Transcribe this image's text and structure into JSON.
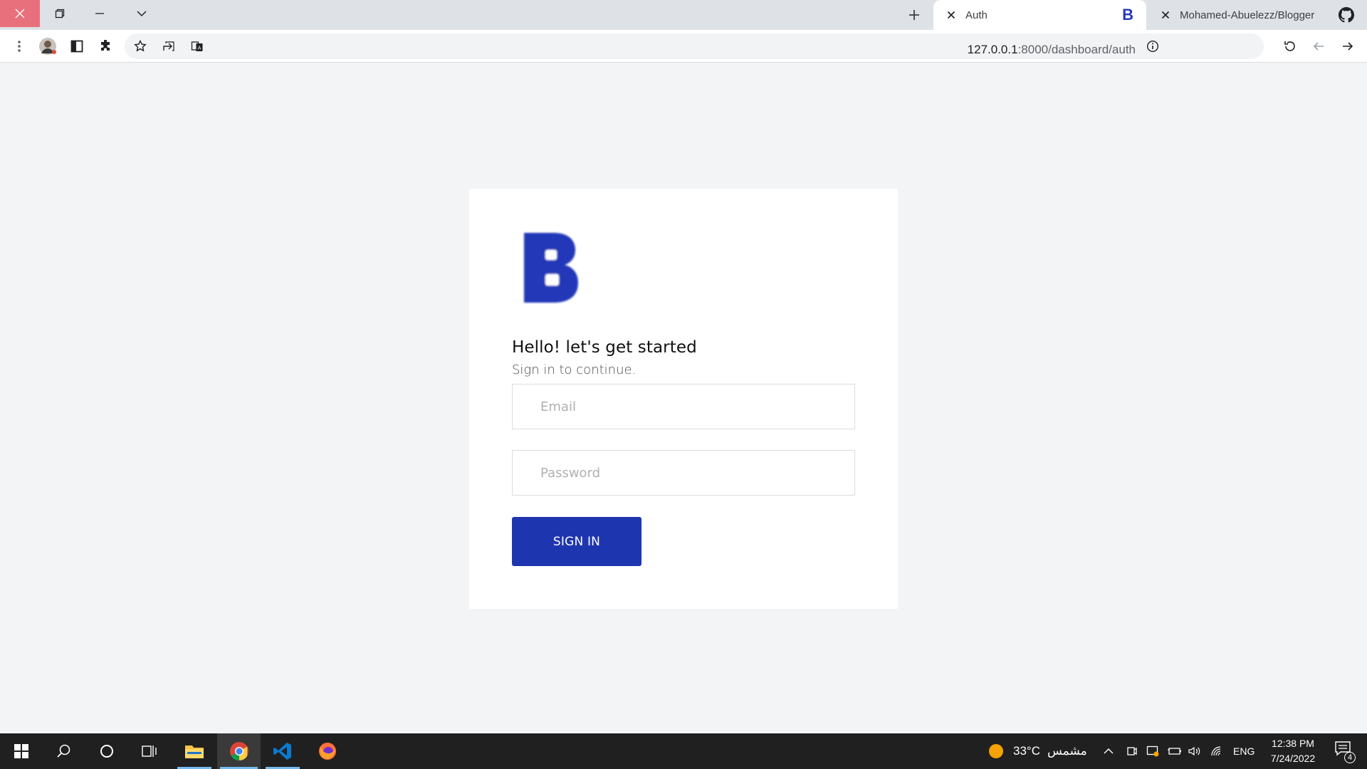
{
  "browser": {
    "tabs": [
      {
        "title": "Auth",
        "favicon": "blogger-b-favicon",
        "active": true
      },
      {
        "title": "Mohamed-Abuelezz/Blogger",
        "favicon": "github-icon",
        "active": false
      }
    ],
    "url_host": "127.0.0.1",
    "url_path": ":8000/dashboard/auth"
  },
  "login": {
    "logo_letter": "B",
    "brand_color": "#2439b8",
    "heading": "Hello! let's get started",
    "subheading": "Sign in to continue.",
    "email_placeholder": "Email",
    "password_placeholder": "Password",
    "signin_label": "SIGN IN",
    "button_color": "#1e35b0"
  },
  "taskbar": {
    "weather_temp": "33°C",
    "weather_text": "مشمس",
    "language": "ENG",
    "time": "12:38 PM",
    "date": "7/24/2022",
    "notification_count": "4"
  }
}
